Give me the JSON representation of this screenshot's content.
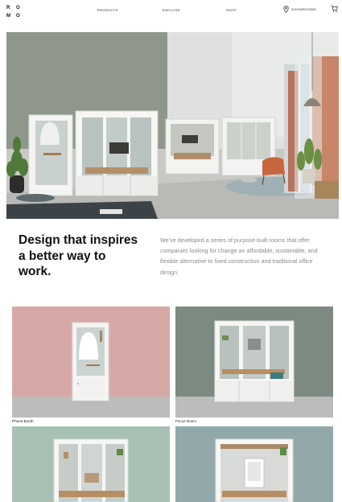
{
  "header": {
    "logo_letters": [
      "R",
      "O",
      "O",
      "M"
    ],
    "nav": [
      "PRODUCTS",
      "ENCLOSE",
      "SHOP"
    ],
    "showrooms_label": "SHOWROOMS"
  },
  "hero": {
    "image_alt": "Office interior with white glass phone booths and meeting rooms"
  },
  "intro": {
    "headline": "Design that inspires a better way to work.",
    "body": "We've developed a series of purpose-built rooms that offer companies looking for change an affordable, sustainable, and flexible alternative to fixed construction and traditional office design."
  },
  "products": [
    {
      "name": "Phone Booth",
      "background": "#d7a9a6"
    },
    {
      "name": "Focus Room",
      "background": "#7d8a82"
    },
    {
      "name": "",
      "background": "#a9c0b5"
    },
    {
      "name": "",
      "background": "#93a8aa"
    }
  ],
  "colors": {
    "text": "#111111",
    "muted": "#8a8a8a",
    "floor": "#bcbcbc"
  }
}
